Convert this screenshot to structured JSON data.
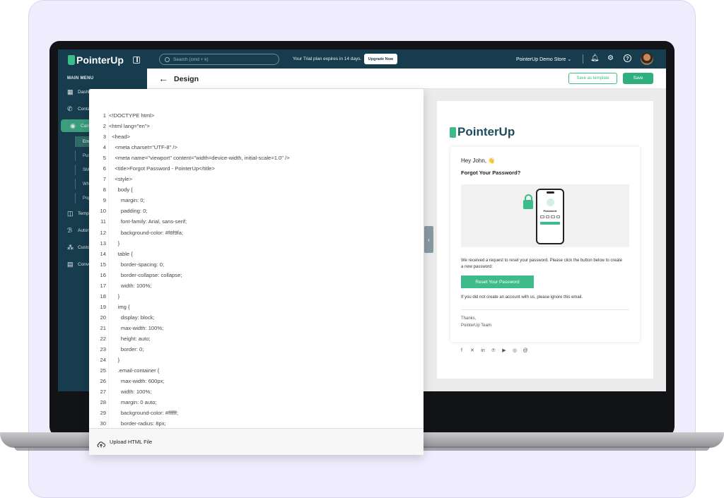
{
  "app": {
    "logo_text": "PointerUp"
  },
  "sidebar": {
    "menu_label": "MAIN MENU",
    "items": [
      {
        "label": "Dashb",
        "icon": "grid-icon"
      },
      {
        "label": "Conta",
        "icon": "phone-icon"
      },
      {
        "label": "Camp",
        "icon": "megaphone-icon"
      },
      {
        "label": "Temp",
        "icon": "template-icon"
      },
      {
        "label": "Autor",
        "icon": "automation-icon"
      },
      {
        "label": "Custo",
        "icon": "users-icon"
      },
      {
        "label": "Conve",
        "icon": "chat-icon"
      }
    ],
    "sub_items": [
      "Ema",
      "Pus",
      "SMS",
      "Wha",
      "Pop"
    ]
  },
  "topbar": {
    "search_placeholder": "Search (cmd + k)",
    "trial_text": "Your Trial plan expires in 14 days.",
    "upgrade_label": "Upgrade Now",
    "store_label": "PointerUp Demo Store"
  },
  "design_header": {
    "title": "Design",
    "save_template_label": "Save as template",
    "save_label": "Save"
  },
  "editor": {
    "lines": [
      "<!DOCTYPE html>",
      "<html lang=\"en\">",
      "  <head>",
      "    <meta charset=\"UTF-8\" />",
      "    <meta name=\"viewport\" content=\"width=device-width, initial-scale=1.0\" />",
      "    <title>Forgot Password - PointerUp</title>",
      "    <style>",
      "      body {",
      "        margin: 0;",
      "        padding: 0;",
      "        font-family: Arial, sans-serif;",
      "        background-color: #f8f9fa;",
      "      }",
      "      table {",
      "        border-spacing: 0;",
      "        border-collapse: collapse;",
      "        width: 100%;",
      "      }",
      "      img {",
      "        display: block;",
      "        max-width: 100%;",
      "        height: auto;",
      "        border: 0;",
      "      }",
      "      .email-container {",
      "        max-width: 600px;",
      "        width: 100%;",
      "        margin: 0 auto;",
      "        background-color: #ffffff;",
      "        border-radius: 8px;"
    ],
    "upload_label": "Upload HTML File"
  },
  "email_preview": {
    "logo_text": "PointerUp",
    "greeting": "Hey John, 👋",
    "heading": "Forgot Your Password?",
    "phone_label": "Password",
    "body_text": "We received a request to reset your password. Please click the button below to create a new password:",
    "button_label": "Reset Your Password",
    "ignore_text": "If you did not create an account with us, please ignore this email.",
    "thanks": "Thanks,",
    "team": "PointerUp Team",
    "socials": [
      "facebook-icon",
      "x-icon",
      "linkedin-icon",
      "pinterest-icon",
      "youtube-icon",
      "instagram-icon",
      "threads-icon"
    ]
  },
  "colors": {
    "sidebar_bg": "#173c4e",
    "accent_green": "#3dbb8a",
    "backdrop": "#efedfd"
  }
}
